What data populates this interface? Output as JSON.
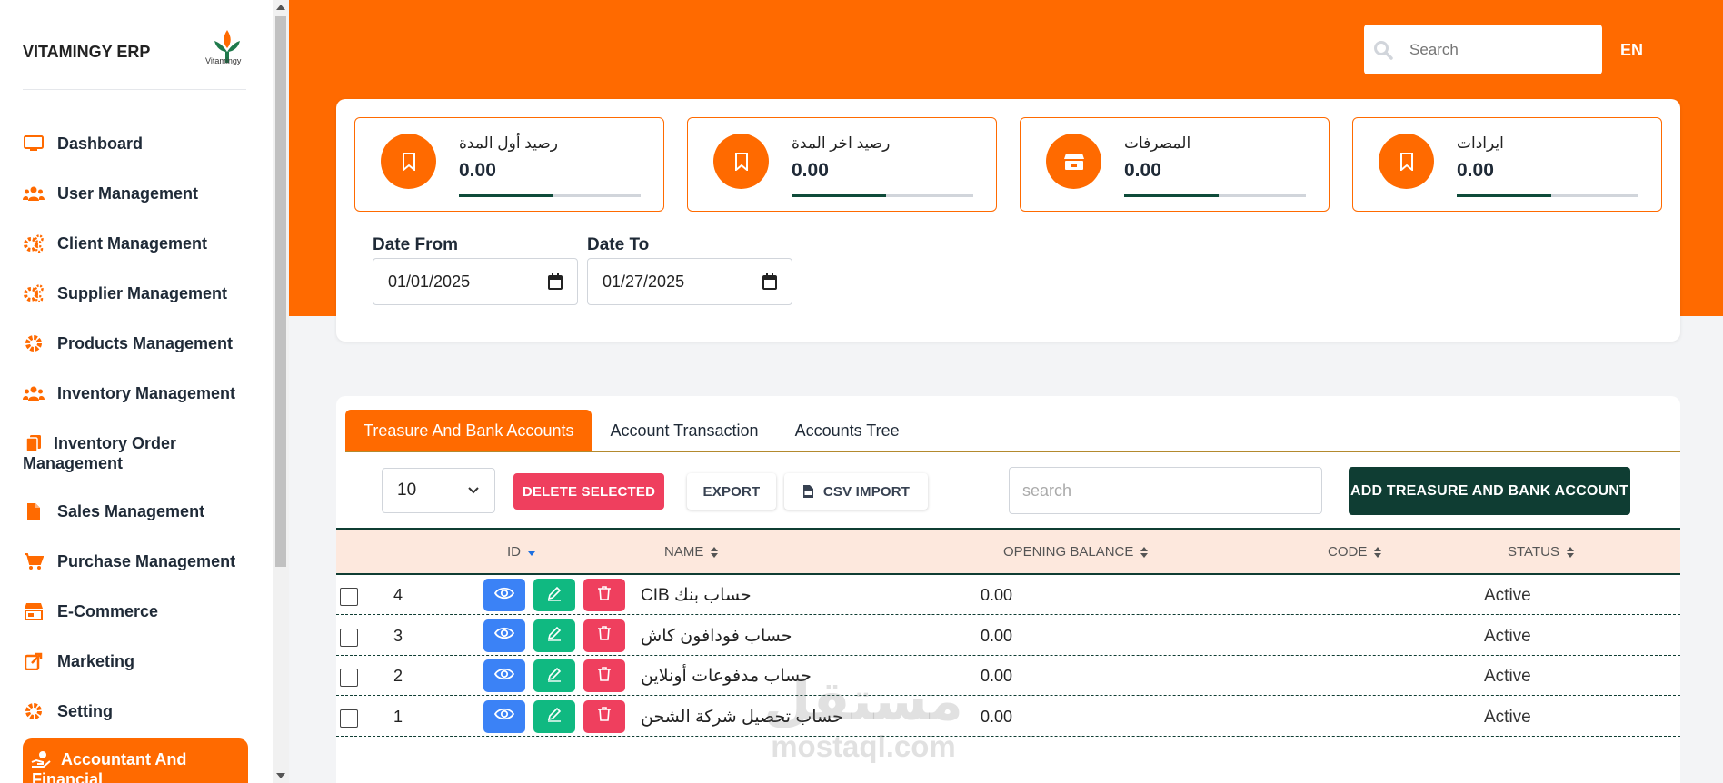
{
  "app": {
    "brand": "VITAMINGY ERP",
    "logo_text": "Vitamingy",
    "accent": "#ff6a00",
    "dark": "#0f3d33"
  },
  "sidebar": {
    "items": [
      {
        "label": "Dashboard",
        "icon": "monitor-icon"
      },
      {
        "label": "User Management",
        "icon": "users-icon"
      },
      {
        "label": "Client Management",
        "icon": "gears-icon"
      },
      {
        "label": "Supplier Management",
        "icon": "gears-icon"
      },
      {
        "label": "Products Management",
        "icon": "gear-icon"
      },
      {
        "label": "Inventory Management",
        "icon": "users-icon"
      },
      {
        "label": "Inventory Order Management",
        "icon": "copy-icon"
      },
      {
        "label": "Sales Management",
        "icon": "file-icon"
      },
      {
        "label": "Purchase Management",
        "icon": "cart-icon"
      },
      {
        "label": "E-Commerce",
        "icon": "store-icon"
      },
      {
        "label": "Marketing",
        "icon": "share-icon"
      },
      {
        "label": "Setting",
        "icon": "gear-icon"
      },
      {
        "label": "Accountant And Financial",
        "icon": "hand-coin-icon",
        "active": true
      }
    ]
  },
  "header": {
    "search_placeholder": "Search",
    "language": "EN"
  },
  "stats": [
    {
      "title": "رصيد أول المدة",
      "value": "0.00",
      "icon": "bookmark-icon",
      "progress": 0.52
    },
    {
      "title": "رصيد اخر المدة",
      "value": "0.00",
      "icon": "bookmark-icon",
      "progress": 0.52
    },
    {
      "title": "المصرفات",
      "value": "0.00",
      "icon": "store-icon",
      "progress": 0.52
    },
    {
      "title": "ايرادات",
      "value": "0.00",
      "icon": "bookmark-icon",
      "progress": 0.52
    }
  ],
  "filters": {
    "date_from_label": "Date From",
    "date_from": "01/01/2025",
    "date_to_label": "Date To",
    "date_to": "01/27/2025"
  },
  "tabs": [
    {
      "label": "Treasure And Bank Accounts",
      "active": true
    },
    {
      "label": "Account Transaction"
    },
    {
      "label": "Accounts Tree"
    }
  ],
  "toolbar": {
    "page_size": "10",
    "delete_label": "DELETE SELECTED",
    "export_label": "EXPORT",
    "csv_label": "CSV IMPORT",
    "search_placeholder": "search",
    "add_label": "ADD TREASURE AND BANK ACCOUNT"
  },
  "table": {
    "columns": [
      "ID",
      "NAME",
      "OPENING BALANCE",
      "CODE",
      "STATUS"
    ],
    "rows": [
      {
        "id": "4",
        "name": "حساب بنك CIB",
        "balance": "0.00",
        "code": "",
        "status": "Active"
      },
      {
        "id": "3",
        "name": "حساب فودافون كاش",
        "balance": "0.00",
        "code": "",
        "status": "Active"
      },
      {
        "id": "2",
        "name": "حساب مدفوعات أونلاين",
        "balance": "0.00",
        "code": "",
        "status": "Active"
      },
      {
        "id": "1",
        "name": "حساب تحصيل شركة الشحن",
        "balance": "0.00",
        "code": "",
        "status": "Active"
      }
    ]
  },
  "watermark": {
    "arabic": "مستقل",
    "latin": "mostaql.com"
  }
}
